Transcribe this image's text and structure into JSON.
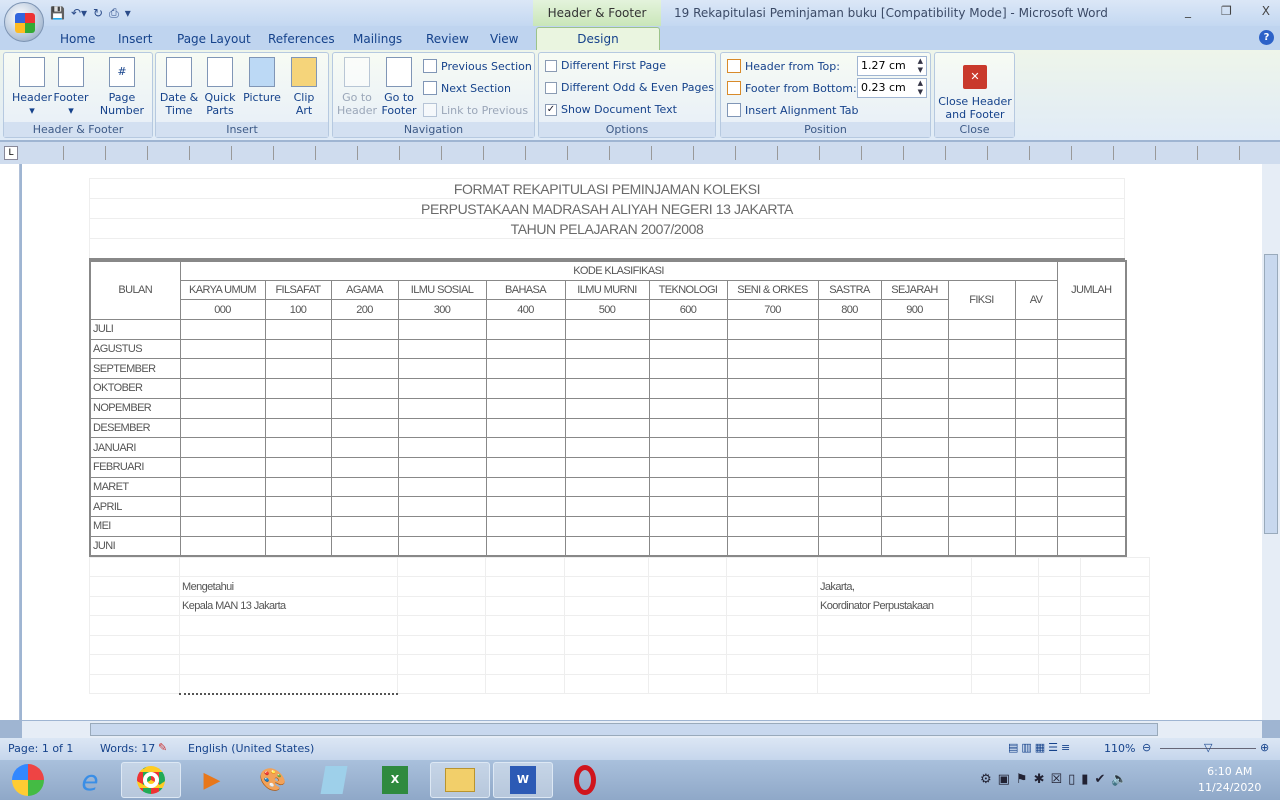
{
  "window": {
    "title": "19 Rekapitulasi Peminjaman buku [Compatibility Mode] - Microsoft Word",
    "context_tab": "Header & Footer Tools",
    "minimize": "_",
    "restore": "❐",
    "close": "X"
  },
  "tabs": [
    "Home",
    "Insert",
    "Page Layout",
    "References",
    "Mailings",
    "Review",
    "View"
  ],
  "active_tab": "Design",
  "ribbon": {
    "hf": {
      "label": "Header & Footer",
      "header": "Header",
      "footer": "Footer",
      "page_number": "Page Number"
    },
    "insert": {
      "label": "Insert",
      "date_time": "Date & Time",
      "quick_parts": "Quick Parts",
      "picture": "Picture",
      "clip_art": "Clip Art"
    },
    "nav": {
      "label": "Navigation",
      "go_header": "Go to Header",
      "go_footer": "Go to Footer",
      "prev": "Previous Section",
      "next": "Next Section",
      "link": "Link to Previous"
    },
    "options": {
      "label": "Options",
      "diff_first": "Different First Page",
      "diff_odd": "Different Odd & Even Pages",
      "show_text": "Show Document Text",
      "checked": [
        false,
        false,
        true
      ]
    },
    "position": {
      "label": "Position",
      "header_top": "Header from Top:",
      "header_top_val": "1.27 cm",
      "footer_bottom": "Footer from Bottom:",
      "footer_bottom_val": "0.23 cm",
      "align_tab": "Insert Alignment Tab"
    },
    "close": {
      "label": "Close",
      "button": "Close Header and Footer"
    }
  },
  "document": {
    "titles": [
      "FORMAT REKAPITULASI PEMINJAMAN KOLEKSI",
      "PERPUSTAKAAN MADRASAH ALIYAH NEGERI 13 JAKARTA",
      "TAHUN PELAJARAN 2007/2008"
    ],
    "bulan": "BULAN",
    "kode": "KODE KLASIFIKASI",
    "fiksi": "FIKSI",
    "av": "AV",
    "jumlah": "JUMLAH",
    "categories": [
      {
        "name": "KARYA UMUM",
        "code": "000"
      },
      {
        "name": "FILSAFAT",
        "code": "100"
      },
      {
        "name": "AGAMA",
        "code": "200"
      },
      {
        "name": "ILMU SOSIAL",
        "code": "300"
      },
      {
        "name": "BAHASA",
        "code": "400"
      },
      {
        "name": "ILMU MURNI",
        "code": "500"
      },
      {
        "name": "TEKNOLOGI",
        "code": "600"
      },
      {
        "name": "SENI & ORKES",
        "code": "700"
      },
      {
        "name": "SASTRA",
        "code": "800"
      },
      {
        "name": "SEJARAH",
        "code": "900"
      }
    ],
    "months": [
      "JULI",
      "AGUSTUS",
      "SEPTEMBER",
      "OKTOBER",
      "NOPEMBER",
      "DESEMBER",
      "JANUARI",
      "FEBRUARI",
      "MARET",
      "APRIL",
      "MEI",
      "JUNI"
    ],
    "sign_left": [
      "Mengetahui",
      "Kepala MAN 13 Jakarta"
    ],
    "sign_right": [
      "Jakarta,",
      "Koordinator Perpustakaan"
    ]
  },
  "status": {
    "page": "Page: 1 of 1",
    "words": "Words: 17",
    "language": "English (United States)",
    "zoom": "110%",
    "zoom_percent": 110
  },
  "clock": {
    "time": "6:10 AM",
    "date": "11/24/2020"
  }
}
